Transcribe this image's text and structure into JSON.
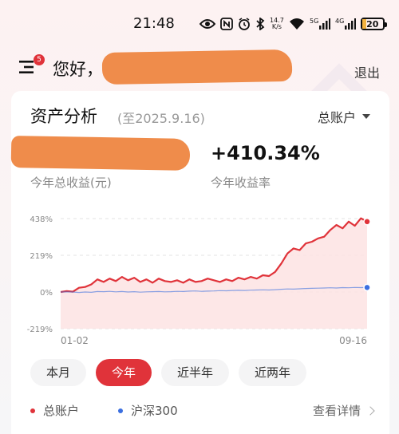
{
  "status_bar": {
    "time": "21:48",
    "net_speed_value": "14.7",
    "net_speed_unit": "K/s",
    "signal_1_label": "5G",
    "signal_2_label": "4G",
    "battery": "20"
  },
  "header": {
    "menu_badge": "5",
    "greeting": "您好，",
    "logout": "退出"
  },
  "card": {
    "title": "资产分析",
    "date": "(至2025.9.16)",
    "account_select": "总账户",
    "income_label": "今年总收益(元)",
    "rate_value": "+410.34%",
    "rate_label": "今年收益率"
  },
  "chart_data": {
    "type": "line",
    "x_start": "01-02",
    "x_end": "09-16",
    "yticks": [
      "438%",
      "219%",
      "0%",
      "-219%"
    ],
    "ylim": [
      -219,
      438
    ],
    "grid": true,
    "series": [
      {
        "name": "总账户",
        "color": "#e0333a",
        "values": [
          0,
          5,
          2,
          25,
          30,
          45,
          75,
          60,
          80,
          65,
          90,
          70,
          85,
          60,
          75,
          55,
          80,
          65,
          60,
          70,
          55,
          75,
          60,
          65,
          80,
          70,
          60,
          75,
          65,
          85,
          75,
          90,
          80,
          100,
          95,
          120,
          170,
          230,
          260,
          250,
          290,
          300,
          320,
          330,
          370,
          400,
          380,
          420,
          395,
          440,
          420
        ]
      },
      {
        "name": "沪深300",
        "color": "#3b6fe0",
        "values": [
          0,
          1,
          0,
          -3,
          0,
          -2,
          3,
          2,
          4,
          1,
          3,
          0,
          2,
          -1,
          1,
          2,
          3,
          1,
          2,
          4,
          3,
          5,
          6,
          4,
          5,
          6,
          8,
          7,
          9,
          10,
          9,
          11,
          12,
          13,
          12,
          14,
          16,
          18,
          17,
          19,
          21,
          22,
          23,
          24,
          25,
          24,
          26,
          25,
          27,
          26,
          27
        ]
      }
    ]
  },
  "tabs": [
    "本月",
    "今年",
    "近半年",
    "近两年"
  ],
  "active_tab": 1,
  "legend": {
    "account": "总账户",
    "index": "沪深300",
    "details": "查看详情"
  }
}
